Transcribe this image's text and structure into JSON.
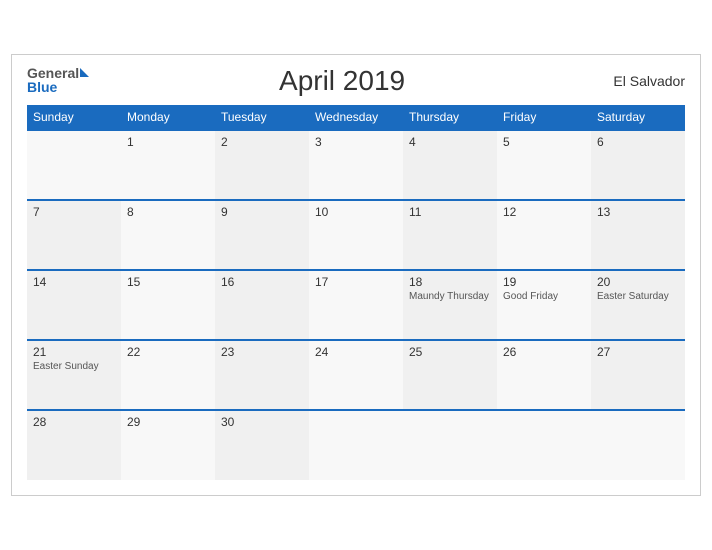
{
  "header": {
    "title": "April 2019",
    "country": "El Salvador",
    "logo_general": "General",
    "logo_blue": "Blue"
  },
  "weekdays": [
    "Sunday",
    "Monday",
    "Tuesday",
    "Wednesday",
    "Thursday",
    "Friday",
    "Saturday"
  ],
  "weeks": [
    [
      {
        "day": "",
        "holiday": ""
      },
      {
        "day": "1",
        "holiday": ""
      },
      {
        "day": "2",
        "holiday": ""
      },
      {
        "day": "3",
        "holiday": ""
      },
      {
        "day": "4",
        "holiday": ""
      },
      {
        "day": "5",
        "holiday": ""
      },
      {
        "day": "6",
        "holiday": ""
      }
    ],
    [
      {
        "day": "7",
        "holiday": ""
      },
      {
        "day": "8",
        "holiday": ""
      },
      {
        "day": "9",
        "holiday": ""
      },
      {
        "day": "10",
        "holiday": ""
      },
      {
        "day": "11",
        "holiday": ""
      },
      {
        "day": "12",
        "holiday": ""
      },
      {
        "day": "13",
        "holiday": ""
      }
    ],
    [
      {
        "day": "14",
        "holiday": ""
      },
      {
        "day": "15",
        "holiday": ""
      },
      {
        "day": "16",
        "holiday": ""
      },
      {
        "day": "17",
        "holiday": ""
      },
      {
        "day": "18",
        "holiday": "Maundy Thursday"
      },
      {
        "day": "19",
        "holiday": "Good Friday"
      },
      {
        "day": "20",
        "holiday": "Easter Saturday"
      }
    ],
    [
      {
        "day": "21",
        "holiday": "Easter Sunday"
      },
      {
        "day": "22",
        "holiday": ""
      },
      {
        "day": "23",
        "holiday": ""
      },
      {
        "day": "24",
        "holiday": ""
      },
      {
        "day": "25",
        "holiday": ""
      },
      {
        "day": "26",
        "holiday": ""
      },
      {
        "day": "27",
        "holiday": ""
      }
    ],
    [
      {
        "day": "28",
        "holiday": ""
      },
      {
        "day": "29",
        "holiday": ""
      },
      {
        "day": "30",
        "holiday": ""
      },
      {
        "day": "",
        "holiday": ""
      },
      {
        "day": "",
        "holiday": ""
      },
      {
        "day": "",
        "holiday": ""
      },
      {
        "day": "",
        "holiday": ""
      }
    ]
  ]
}
